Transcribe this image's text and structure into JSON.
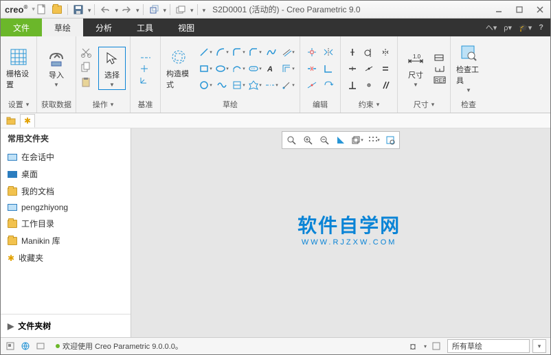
{
  "title": {
    "logo": "creo",
    "doc": "S2D0001 (活动的) - Creo Parametric 9.0"
  },
  "tabs": {
    "file": "文件",
    "active": "草绘",
    "t2": "分析",
    "t3": "工具",
    "t4": "视图"
  },
  "ribbon": {
    "g1": {
      "label": "设置",
      "btn": "栅格设置"
    },
    "g2": {
      "label": "获取数据",
      "btn": "导入"
    },
    "g3": {
      "label": "操作",
      "btn": "选择"
    },
    "g4": {
      "label": "基准"
    },
    "g5": {
      "label": "草绘",
      "btn": "构造模式"
    },
    "g6": {
      "label": "编辑"
    },
    "g7": {
      "label": "约束"
    },
    "g8": {
      "label": "尺寸",
      "btn": "尺寸"
    },
    "g9": {
      "label": "检查",
      "btn": "检查工具"
    }
  },
  "sidebar": {
    "header": "常用文件夹",
    "items": [
      "在会话中",
      "桌面",
      "我的文档",
      "pengzhiyong",
      "工作目录",
      "Manikin 库",
      "收藏夹"
    ],
    "tree": "文件夹树"
  },
  "watermark": {
    "line1": "软件自学网",
    "line2": "WWW.RJZXW.COM"
  },
  "status": {
    "msg": "欢迎使用 Creo Parametric 9.0.0.0。",
    "filter": "所有草绘"
  }
}
